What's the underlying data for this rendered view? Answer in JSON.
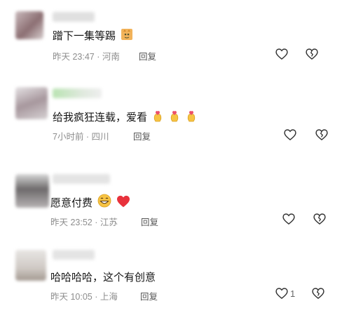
{
  "comments": [
    {
      "text": "蹭下一集等踢",
      "time": "昨天 23:47 · 河南",
      "reply": "回复",
      "like_count": ""
    },
    {
      "text": "给我疯狂连载，爱看",
      "time": "7小时前 · 四川",
      "reply": "回复",
      "like_count": ""
    },
    {
      "text": "愿意付费",
      "time": "昨天 23:52 · 江苏",
      "reply": "回复",
      "like_count": ""
    },
    {
      "text": "哈哈哈哈，这个有创意",
      "time": "昨天 10:05 · 上海",
      "reply": "回复",
      "like_count": "1"
    }
  ],
  "icons": {
    "like": "heart-outline-icon",
    "dislike": "broken-heart-outline-icon"
  },
  "colors": {
    "text": "#161616",
    "meta": "#8d8d8d",
    "icon": "#333333",
    "heart_red": "#e8323c",
    "emoji_yellow": "#f7c343"
  }
}
